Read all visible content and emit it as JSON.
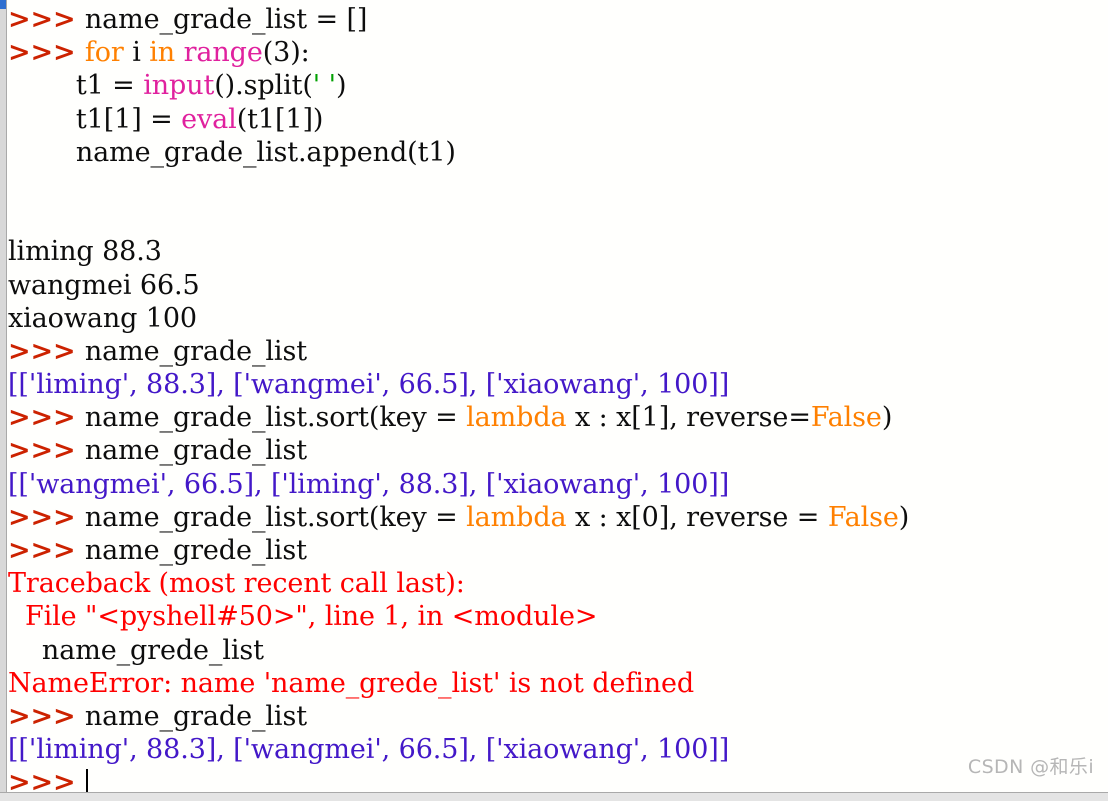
{
  "window": {
    "app": "Python IDLE Shell",
    "background_color": "#fffffd",
    "scrollbar_color": "#d8d8d8",
    "scrollbar_thumb_color": "#2f6fd0"
  },
  "colors": {
    "prompt": "#cc2200",
    "plain": "#0d0d0d",
    "keyword": "#ff8000",
    "builtin": "#e0219e",
    "string": "#00a000",
    "stdout": "#4318c8",
    "error": "#ff0000",
    "cursor": "#000000",
    "watermark": "#b6b6b6"
  },
  "prompt": ">>> ",
  "watermark": "CSDN @和乐i",
  "lines": [
    {
      "id": "line-1",
      "kind": "input",
      "tokens": [
        {
          "t": "prompt",
          "s": ">>> "
        },
        {
          "t": "plain",
          "s": "name_grade_list = []"
        }
      ]
    },
    {
      "id": "line-2",
      "kind": "input",
      "tokens": [
        {
          "t": "prompt",
          "s": ">>> "
        },
        {
          "t": "keyword",
          "s": "for"
        },
        {
          "t": "plain",
          "s": " i "
        },
        {
          "t": "keyword",
          "s": "in"
        },
        {
          "t": "plain",
          "s": " "
        },
        {
          "t": "builtin",
          "s": "range"
        },
        {
          "t": "plain",
          "s": "(3):"
        }
      ]
    },
    {
      "id": "line-3",
      "kind": "input",
      "tokens": [
        {
          "t": "plain",
          "s": "        t1 = "
        },
        {
          "t": "builtin",
          "s": "input"
        },
        {
          "t": "plain",
          "s": "().split("
        },
        {
          "t": "string",
          "s": "' '"
        },
        {
          "t": "plain",
          "s": ")"
        }
      ]
    },
    {
      "id": "line-4",
      "kind": "input",
      "tokens": [
        {
          "t": "plain",
          "s": "        t1[1] = "
        },
        {
          "t": "builtin",
          "s": "eval"
        },
        {
          "t": "plain",
          "s": "(t1[1])"
        }
      ]
    },
    {
      "id": "line-5",
      "kind": "input",
      "tokens": [
        {
          "t": "plain",
          "s": "        name_grade_list.append(t1)"
        }
      ]
    },
    {
      "id": "line-6",
      "kind": "blank",
      "tokens": [
        {
          "t": "plain",
          "s": " "
        }
      ]
    },
    {
      "id": "line-7",
      "kind": "blank",
      "tokens": [
        {
          "t": "plain",
          "s": " "
        }
      ]
    },
    {
      "id": "line-8",
      "kind": "user-typed",
      "tokens": [
        {
          "t": "plain",
          "s": "liming 88.3"
        }
      ]
    },
    {
      "id": "line-9",
      "kind": "user-typed",
      "tokens": [
        {
          "t": "plain",
          "s": "wangmei 66.5"
        }
      ]
    },
    {
      "id": "line-10",
      "kind": "user-typed",
      "tokens": [
        {
          "t": "plain",
          "s": "xiaowang 100"
        }
      ]
    },
    {
      "id": "line-11",
      "kind": "input",
      "tokens": [
        {
          "t": "prompt",
          "s": ">>> "
        },
        {
          "t": "plain",
          "s": "name_grade_list"
        }
      ]
    },
    {
      "id": "line-12",
      "kind": "output",
      "tokens": [
        {
          "t": "stdout",
          "s": "[['liming', 88.3], ['wangmei', 66.5], ['xiaowang', 100]]"
        }
      ]
    },
    {
      "id": "line-13",
      "kind": "input",
      "tokens": [
        {
          "t": "prompt",
          "s": ">>> "
        },
        {
          "t": "plain",
          "s": "name_grade_list.sort(key = "
        },
        {
          "t": "keyword",
          "s": "lambda"
        },
        {
          "t": "plain",
          "s": " x : x[1], reverse="
        },
        {
          "t": "literal",
          "s": "False"
        },
        {
          "t": "plain",
          "s": ")"
        }
      ]
    },
    {
      "id": "line-14",
      "kind": "input",
      "tokens": [
        {
          "t": "prompt",
          "s": ">>> "
        },
        {
          "t": "plain",
          "s": "name_grade_list"
        }
      ]
    },
    {
      "id": "line-15",
      "kind": "output",
      "tokens": [
        {
          "t": "stdout",
          "s": "[['wangmei', 66.5], ['liming', 88.3], ['xiaowang', 100]]"
        }
      ]
    },
    {
      "id": "line-16",
      "kind": "input",
      "tokens": [
        {
          "t": "prompt",
          "s": ">>> "
        },
        {
          "t": "plain",
          "s": "name_grade_list.sort(key = "
        },
        {
          "t": "keyword",
          "s": "lambda"
        },
        {
          "t": "plain",
          "s": " x : x[0], reverse = "
        },
        {
          "t": "literal",
          "s": "False"
        },
        {
          "t": "plain",
          "s": ")"
        }
      ]
    },
    {
      "id": "line-17",
      "kind": "input",
      "tokens": [
        {
          "t": "prompt",
          "s": ">>> "
        },
        {
          "t": "plain",
          "s": "name_grede_list"
        }
      ]
    },
    {
      "id": "line-18",
      "kind": "error",
      "tokens": [
        {
          "t": "error",
          "s": "Traceback (most recent call last):"
        }
      ]
    },
    {
      "id": "line-19",
      "kind": "error",
      "tokens": [
        {
          "t": "error",
          "s": "  File \"<pyshell#50>\", line 1, in <module>"
        }
      ]
    },
    {
      "id": "line-20",
      "kind": "error-source",
      "tokens": [
        {
          "t": "plain",
          "s": "    name_grede_list"
        }
      ]
    },
    {
      "id": "line-21",
      "kind": "error",
      "tokens": [
        {
          "t": "error",
          "s": "NameError: name 'name_grede_list' is not defined"
        }
      ]
    },
    {
      "id": "line-22",
      "kind": "input",
      "tokens": [
        {
          "t": "prompt",
          "s": ">>> "
        },
        {
          "t": "plain",
          "s": "name_grade_list"
        }
      ]
    },
    {
      "id": "line-23",
      "kind": "output",
      "tokens": [
        {
          "t": "stdout",
          "s": "[['liming', 88.3], ['wangmei', 66.5], ['xiaowang', 100]]"
        }
      ]
    },
    {
      "id": "line-24",
      "kind": "current-prompt",
      "tokens": [
        {
          "t": "prompt",
          "s": ">>> "
        }
      ],
      "cursor": true
    }
  ]
}
